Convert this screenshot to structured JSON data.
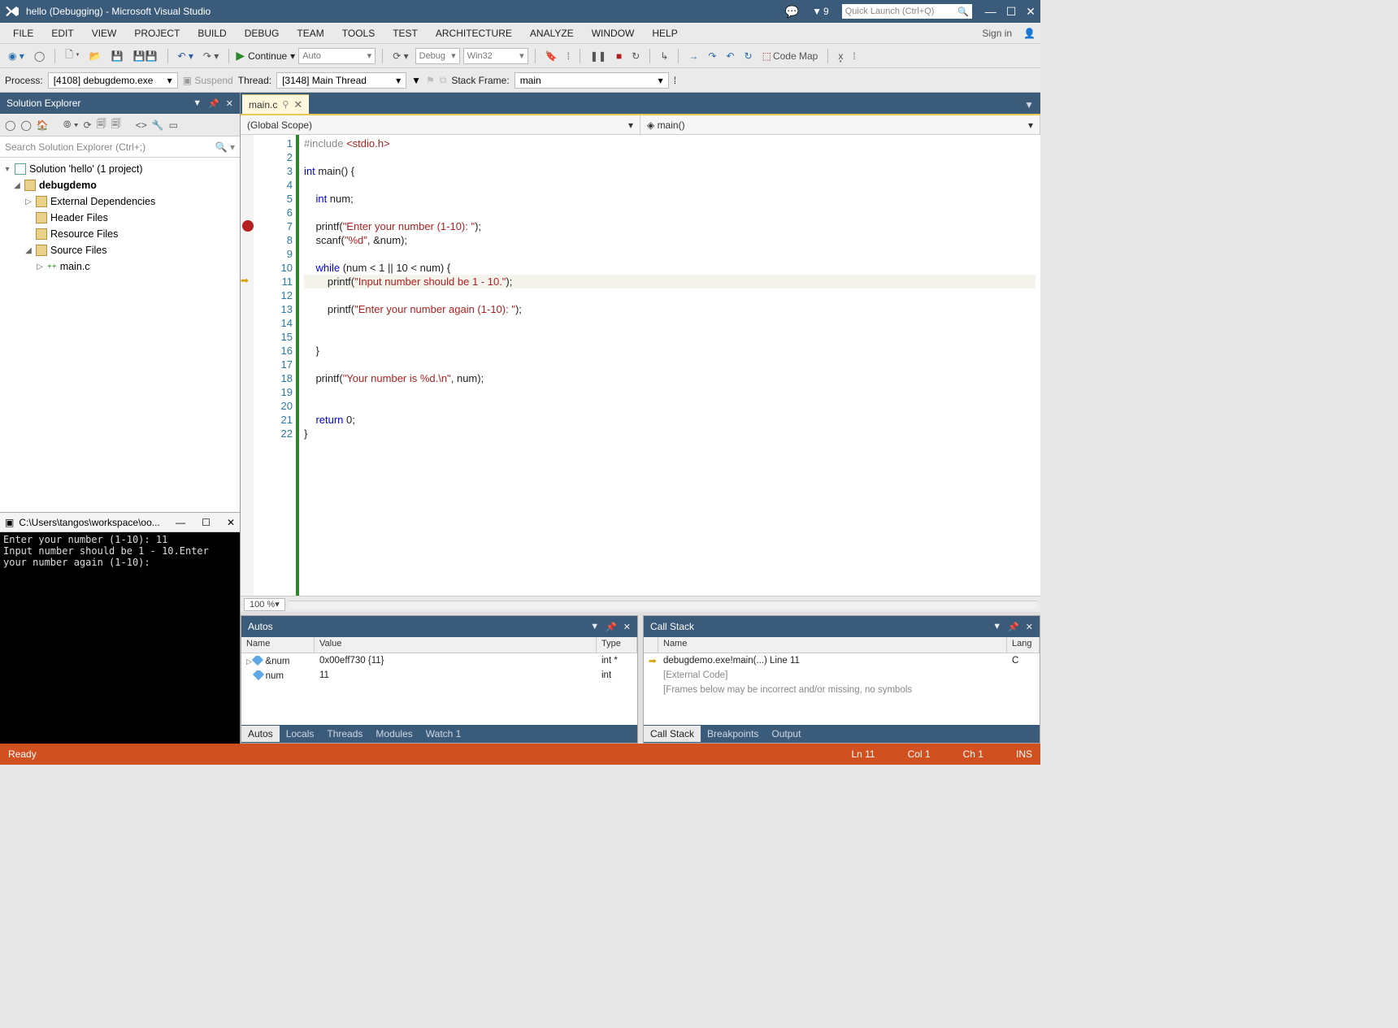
{
  "titlebar": {
    "title": "hello (Debugging) - Microsoft Visual Studio",
    "notifications_count": "9",
    "quicklaunch_placeholder": "Quick Launch (Ctrl+Q)"
  },
  "menubar": {
    "items": [
      "FILE",
      "EDIT",
      "VIEW",
      "PROJECT",
      "BUILD",
      "DEBUG",
      "TEAM",
      "TOOLS",
      "TEST",
      "ARCHITECTURE",
      "ANALYZE",
      "WINDOW",
      "HELP"
    ],
    "signin": "Sign in"
  },
  "toolbar": {
    "continue_label": "Continue",
    "config_platform_1": "Auto",
    "config_platform_2": "Debug",
    "config_platform_3": "Win32",
    "codemap": "Code Map"
  },
  "debugbar": {
    "process_label": "Process:",
    "process_value": "[4108] debugdemo.exe",
    "suspend": "Suspend",
    "thread_label": "Thread:",
    "thread_value": "[3148] Main Thread",
    "stackframe_label": "Stack Frame:",
    "stackframe_value": "main"
  },
  "solution_explorer": {
    "title": "Solution Explorer",
    "search_placeholder": "Search Solution Explorer (Ctrl+;)",
    "root": "Solution 'hello' (1 project)",
    "project": "debugdemo",
    "folders": [
      "External Dependencies",
      "Header Files",
      "Resource Files",
      "Source Files"
    ],
    "sourcefile": "main.c"
  },
  "console": {
    "title": "C:\\Users\\tangos\\workspace\\oo...",
    "text": "Enter your number (1-10): 11\nInput number should be 1 - 10.Enter your number again (1-10): "
  },
  "editor": {
    "tab_name": "main.c",
    "scope_left": "(Global Scope)",
    "scope_right": "main()",
    "zoom": "100 %",
    "breakpoint_line": 7,
    "current_line": 11,
    "lines": [
      {
        "n": 1,
        "html": "<span class='pp'>#include</span> <span class='inc'>&lt;stdio.h&gt;</span>"
      },
      {
        "n": 2,
        "html": ""
      },
      {
        "n": 3,
        "html": "<span class='kw'>int</span> main() {"
      },
      {
        "n": 4,
        "html": ""
      },
      {
        "n": 5,
        "html": "    <span class='kw'>int</span> num;"
      },
      {
        "n": 6,
        "html": ""
      },
      {
        "n": 7,
        "html": "    printf(<span class='str'>\"Enter your number (1-10): \"</span>);"
      },
      {
        "n": 8,
        "html": "    scanf(<span class='str'>\"%d\"</span>, &amp;num);"
      },
      {
        "n": 9,
        "html": ""
      },
      {
        "n": 10,
        "html": "    <span class='kw'>while</span> (num &lt; 1 || 10 &lt; num) {"
      },
      {
        "n": 11,
        "html": "        printf(<span class='str'>\"Input number should be 1 - 10.\"</span>);"
      },
      {
        "n": 12,
        "html": ""
      },
      {
        "n": 13,
        "html": "        printf(<span class='str'>\"Enter your number again (1-10): \"</span>);"
      },
      {
        "n": 14,
        "html": ""
      },
      {
        "n": 15,
        "html": ""
      },
      {
        "n": 16,
        "html": "    }"
      },
      {
        "n": 17,
        "html": ""
      },
      {
        "n": 18,
        "html": "    printf(<span class='str'>\"Your number is %d.\\n\"</span>, num);"
      },
      {
        "n": 19,
        "html": ""
      },
      {
        "n": 20,
        "html": ""
      },
      {
        "n": 21,
        "html": "    <span class='kw'>return</span> 0;"
      },
      {
        "n": 22,
        "html": "}"
      }
    ]
  },
  "autos": {
    "title": "Autos",
    "columns": [
      "Name",
      "Value",
      "Type"
    ],
    "rows": [
      {
        "name": "&num",
        "value": "0x00eff730 {11}",
        "type": "int *",
        "expander": true
      },
      {
        "name": "num",
        "value": "11",
        "type": "int",
        "expander": false
      }
    ],
    "tabs": [
      "Autos",
      "Locals",
      "Threads",
      "Modules",
      "Watch 1"
    ],
    "active_tab": 0
  },
  "callstack": {
    "title": "Call Stack",
    "columns": [
      "Name",
      "Lang"
    ],
    "rows": [
      {
        "name": "debugdemo.exe!main(...) Line 11",
        "lang": "C",
        "current": true
      },
      {
        "name": "[External Code]",
        "lang": "",
        "muted": true
      },
      {
        "name": "[Frames below may be incorrect and/or missing, no symbols",
        "lang": "",
        "muted": true
      }
    ],
    "tabs": [
      "Call Stack",
      "Breakpoints",
      "Output"
    ],
    "active_tab": 0
  },
  "statusbar": {
    "ready": "Ready",
    "ln": "Ln 11",
    "col": "Col 1",
    "ch": "Ch 1",
    "ins": "INS"
  }
}
